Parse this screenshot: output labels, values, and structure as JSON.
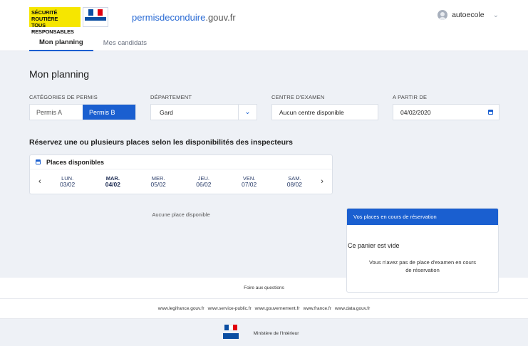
{
  "header": {
    "logo_text": "SÉCURITÉ ROUTIÈRE TOUS RESPONSABLES",
    "logo_line1": "SÉCURITÉ ROUTIÈRE",
    "logo_line2": "TOUS RESPONSABLES",
    "site_name": "permisdeconduire",
    "site_domain": ".gouv.fr",
    "user_name": "autoecole"
  },
  "tabs": [
    {
      "label": "Mon planning",
      "active": true
    },
    {
      "label": "Mes candidats",
      "active": false
    }
  ],
  "page": {
    "title": "Mon planning",
    "filters": {
      "categories_label": "CATÉGORIES DE PERMIS",
      "categories": [
        {
          "label": "Permis A",
          "selected": false
        },
        {
          "label": "Permis B",
          "selected": true
        }
      ],
      "departement_label": "DÉPARTEMENT",
      "departement_value": "Gard",
      "centre_label": "CENTRE D'EXAMEN",
      "centre_value": "Aucun centre disponible",
      "date_label": "A PARTIR DE",
      "date_value": "04/02/2020"
    },
    "section_title": "Réservez une ou plusieurs places selon les disponibilités des inspecteurs",
    "places": {
      "title": "Places disponibles",
      "days": [
        {
          "name": "LUN.",
          "date": "03/02",
          "current": false
        },
        {
          "name": "MAR.",
          "date": "04/02",
          "current": true
        },
        {
          "name": "MER.",
          "date": "05/02",
          "current": false
        },
        {
          "name": "JEU.",
          "date": "06/02",
          "current": false
        },
        {
          "name": "VEN.",
          "date": "07/02",
          "current": false
        },
        {
          "name": "SAM.",
          "date": "08/02",
          "current": false
        }
      ],
      "empty": "Aucune place disponible"
    },
    "cart": {
      "title": "Vos places en cours de réservation",
      "empty_title": "Ce panier est vide",
      "empty_message": "Vous n'avez pas de place d'examen en cours de réservation"
    }
  },
  "footer": {
    "faq": "Foire aux questions",
    "links": [
      "www.legifrance.gouv.fr",
      "www.service-public.fr",
      "www.gouvernement.fr",
      "www.france.fr",
      "www.data.gouv.fr"
    ],
    "ministry": "Ministère de l'Intérieur"
  },
  "colors": {
    "primary": "#1a5fd0",
    "background": "#eef1f6",
    "logo_yellow": "#f6e600"
  }
}
